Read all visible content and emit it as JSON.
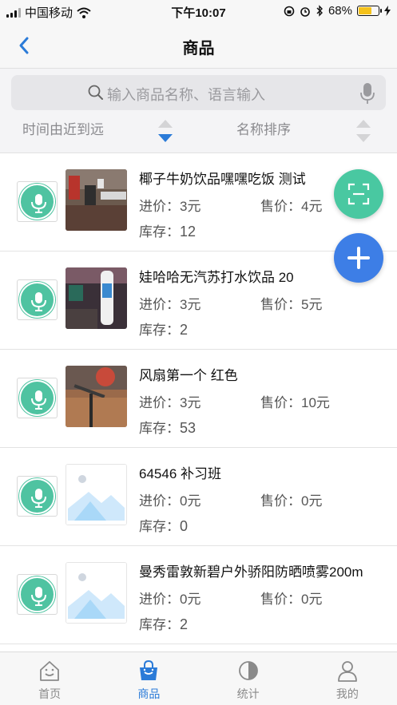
{
  "status_bar": {
    "carrier": "中国移动",
    "time": "下午10:07",
    "battery": "68%",
    "battery_level": 0.68
  },
  "nav": {
    "title": "商品",
    "back_icon": "chevron-left-icon"
  },
  "search": {
    "placeholder": "输入商品名称、语言输入"
  },
  "sort": {
    "time_label": "时间由近到远",
    "name_label": "名称排序"
  },
  "labels": {
    "buy": "进价：",
    "sell": "售价：",
    "stock": "库存："
  },
  "products": [
    {
      "name": "椰子牛奶饮品嘿嘿吃饭 测试",
      "buy": "3元",
      "sell": "4元",
      "stock": "12",
      "image": "photo"
    },
    {
      "name": "娃哈哈无汽苏打水饮品 20",
      "buy": "3元",
      "sell": "5元",
      "stock": "2",
      "image": "photo"
    },
    {
      "name": "风扇第一个 红色",
      "buy": "3元",
      "sell": "10元",
      "stock": "53",
      "image": "photo"
    },
    {
      "name": "64546 补习班",
      "buy": "0元",
      "sell": "0元",
      "stock": "0",
      "image": "placeholder"
    },
    {
      "name": "曼秀雷敦新碧户外骄阳防晒喷雾200m",
      "buy": "0元",
      "sell": "0元",
      "stock": "2",
      "image": "placeholder"
    }
  ],
  "tabs": [
    {
      "label": "首页",
      "icon": "home-icon",
      "active": false
    },
    {
      "label": "商品",
      "icon": "shopping-bag-icon",
      "active": true
    },
    {
      "label": "统计",
      "icon": "pie-chart-icon",
      "active": false
    },
    {
      "label": "我的",
      "icon": "user-icon",
      "active": false
    }
  ],
  "colors": {
    "accent": "#2b7bd8",
    "voice_green": "#4fc3a1",
    "scan_green": "#49c8a1",
    "add_blue": "#3d7ee6"
  }
}
